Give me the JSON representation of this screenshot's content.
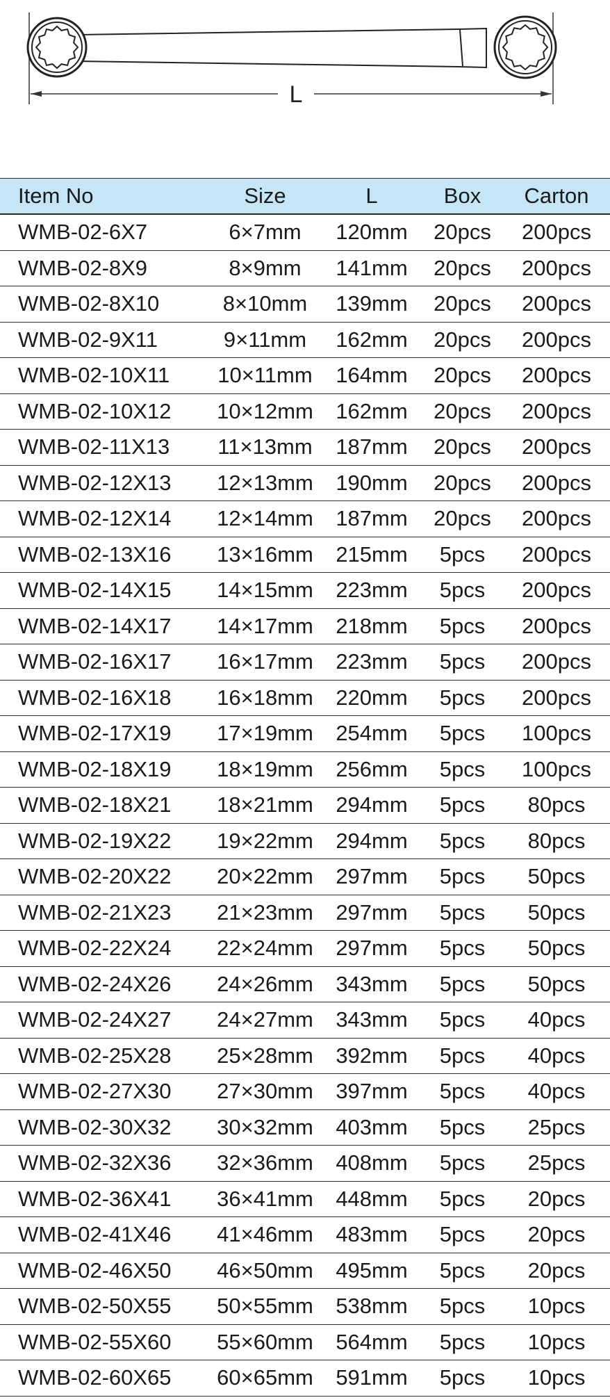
{
  "diagram": {
    "dimension_label": "L"
  },
  "table": {
    "headers": {
      "item_no": "Item No",
      "size": "Size",
      "length": "L",
      "box": "Box",
      "carton": "Carton"
    },
    "rows": [
      {
        "item": "WMB-02-6X7",
        "size": "6×7mm",
        "length": "120mm",
        "box": "20pcs",
        "carton": "200pcs"
      },
      {
        "item": "WMB-02-8X9",
        "size": "8×9mm",
        "length": "141mm",
        "box": "20pcs",
        "carton": "200pcs"
      },
      {
        "item": "WMB-02-8X10",
        "size": "8×10mm",
        "length": "139mm",
        "box": "20pcs",
        "carton": "200pcs"
      },
      {
        "item": "WMB-02-9X11",
        "size": "9×11mm",
        "length": "162mm",
        "box": "20pcs",
        "carton": "200pcs"
      },
      {
        "item": "WMB-02-10X11",
        "size": "10×11mm",
        "length": "164mm",
        "box": "20pcs",
        "carton": "200pcs"
      },
      {
        "item": "WMB-02-10X12",
        "size": "10×12mm",
        "length": "162mm",
        "box": "20pcs",
        "carton": "200pcs"
      },
      {
        "item": "WMB-02-11X13",
        "size": "11×13mm",
        "length": "187mm",
        "box": "20pcs",
        "carton": "200pcs"
      },
      {
        "item": "WMB-02-12X13",
        "size": "12×13mm",
        "length": "190mm",
        "box": "20pcs",
        "carton": "200pcs"
      },
      {
        "item": "WMB-02-12X14",
        "size": "12×14mm",
        "length": "187mm",
        "box": "20pcs",
        "carton": "200pcs"
      },
      {
        "item": "WMB-02-13X16",
        "size": "13×16mm",
        "length": "215mm",
        "box": "5pcs",
        "carton": "200pcs"
      },
      {
        "item": "WMB-02-14X15",
        "size": "14×15mm",
        "length": "223mm",
        "box": "5pcs",
        "carton": "200pcs"
      },
      {
        "item": "WMB-02-14X17",
        "size": "14×17mm",
        "length": "218mm",
        "box": "5pcs",
        "carton": "200pcs"
      },
      {
        "item": "WMB-02-16X17",
        "size": "16×17mm",
        "length": "223mm",
        "box": "5pcs",
        "carton": "200pcs"
      },
      {
        "item": "WMB-02-16X18",
        "size": "16×18mm",
        "length": "220mm",
        "box": "5pcs",
        "carton": "200pcs"
      },
      {
        "item": "WMB-02-17X19",
        "size": "17×19mm",
        "length": "254mm",
        "box": "5pcs",
        "carton": "100pcs"
      },
      {
        "item": "WMB-02-18X19",
        "size": "18×19mm",
        "length": "256mm",
        "box": "5pcs",
        "carton": "100pcs"
      },
      {
        "item": "WMB-02-18X21",
        "size": "18×21mm",
        "length": "294mm",
        "box": "5pcs",
        "carton": "80pcs"
      },
      {
        "item": "WMB-02-19X22",
        "size": "19×22mm",
        "length": "294mm",
        "box": "5pcs",
        "carton": "80pcs"
      },
      {
        "item": "WMB-02-20X22",
        "size": "20×22mm",
        "length": "297mm",
        "box": "5pcs",
        "carton": "50pcs"
      },
      {
        "item": "WMB-02-21X23",
        "size": "21×23mm",
        "length": "297mm",
        "box": "5pcs",
        "carton": "50pcs"
      },
      {
        "item": "WMB-02-22X24",
        "size": "22×24mm",
        "length": "297mm",
        "box": "5pcs",
        "carton": "50pcs"
      },
      {
        "item": "WMB-02-24X26",
        "size": "24×26mm",
        "length": "343mm",
        "box": "5pcs",
        "carton": "50pcs"
      },
      {
        "item": "WMB-02-24X27",
        "size": "24×27mm",
        "length": "343mm",
        "box": "5pcs",
        "carton": "40pcs"
      },
      {
        "item": "WMB-02-25X28",
        "size": "25×28mm",
        "length": "392mm",
        "box": "5pcs",
        "carton": "40pcs"
      },
      {
        "item": "WMB-02-27X30",
        "size": "27×30mm",
        "length": "397mm",
        "box": "5pcs",
        "carton": "40pcs"
      },
      {
        "item": "WMB-02-30X32",
        "size": "30×32mm",
        "length": "403mm",
        "box": "5pcs",
        "carton": "25pcs"
      },
      {
        "item": "WMB-02-32X36",
        "size": "32×36mm",
        "length": "408mm",
        "box": "5pcs",
        "carton": "25pcs"
      },
      {
        "item": "WMB-02-36X41",
        "size": "36×41mm",
        "length": "448mm",
        "box": "5pcs",
        "carton": "20pcs"
      },
      {
        "item": "WMB-02-41X46",
        "size": "41×46mm",
        "length": "483mm",
        "box": "5pcs",
        "carton": "20pcs"
      },
      {
        "item": "WMB-02-46X50",
        "size": "46×50mm",
        "length": "495mm",
        "box": "5pcs",
        "carton": "20pcs"
      },
      {
        "item": "WMB-02-50X55",
        "size": "50×55mm",
        "length": "538mm",
        "box": "5pcs",
        "carton": "10pcs"
      },
      {
        "item": "WMB-02-55X60",
        "size": "55×60mm",
        "length": "564mm",
        "box": "5pcs",
        "carton": "10pcs"
      },
      {
        "item": "WMB-02-60X65",
        "size": "60×65mm",
        "length": "591mm",
        "box": "5pcs",
        "carton": "10pcs"
      }
    ]
  }
}
